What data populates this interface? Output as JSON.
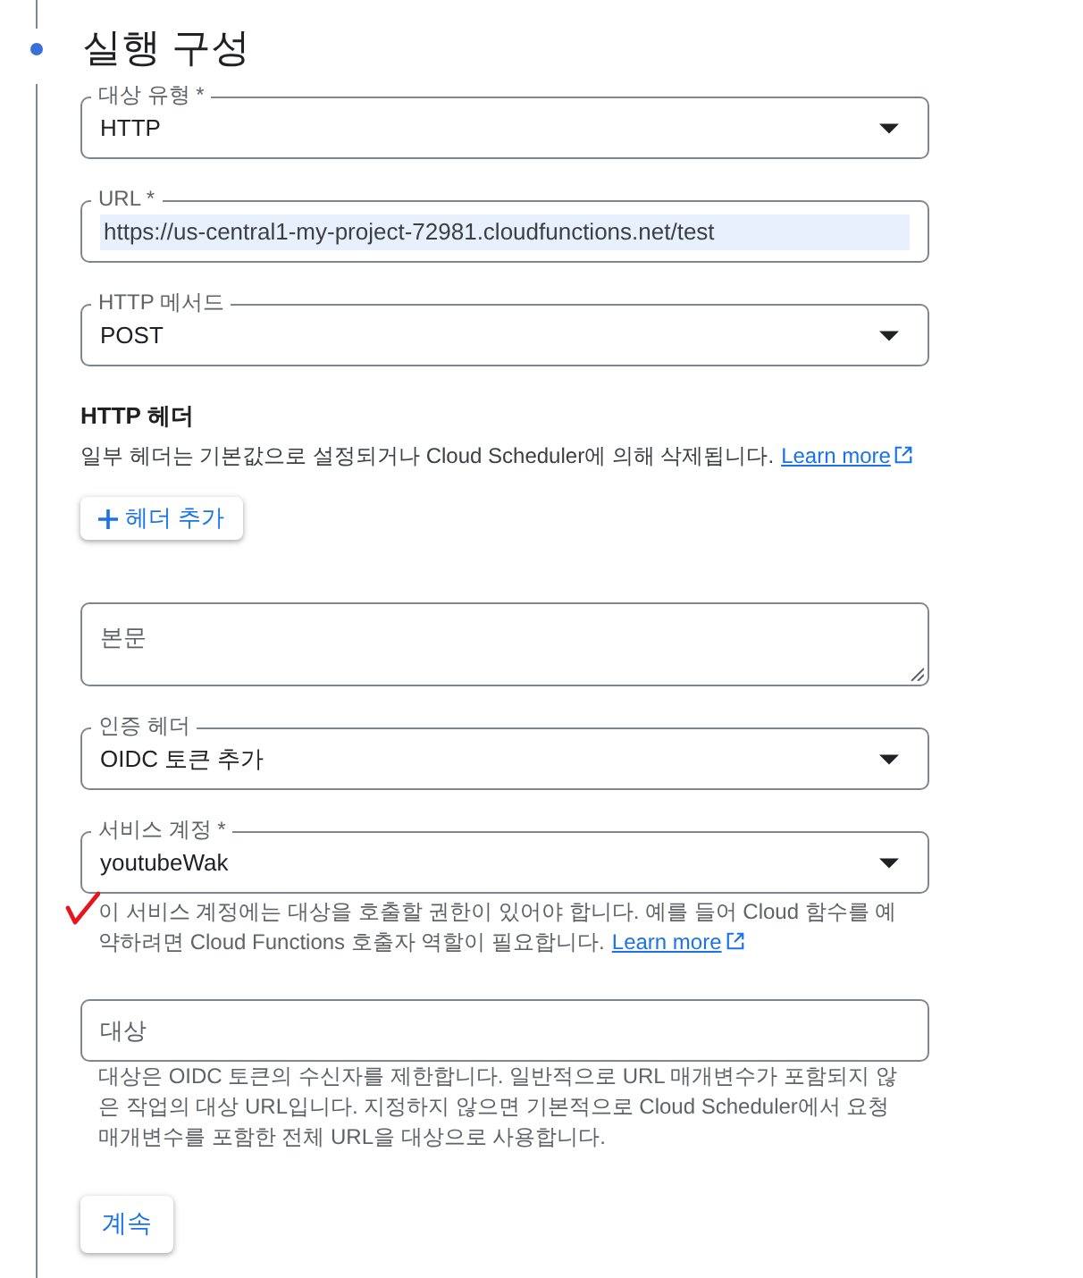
{
  "section": {
    "title": "실행 구성"
  },
  "fields": [
    {
      "kind": "select",
      "label": "대상 유형 *",
      "value": "HTTP"
    },
    {
      "kind": "input",
      "label": "URL *",
      "value": "https://us-central1-my-project-72981.cloudfunctions.net/test",
      "highlighted": true
    },
    {
      "kind": "select",
      "label": "HTTP 메서드",
      "value": "POST"
    },
    {
      "kind": "headers",
      "heading": "HTTP 헤더",
      "help": "일부 헤더는 기본값으로 설정되거나 Cloud Scheduler에 의해 삭제됩니다.",
      "link": "Learn more",
      "button": "헤더 추가"
    },
    {
      "kind": "textarea",
      "placeholder": "본문"
    },
    {
      "kind": "select",
      "label": "인증 헤더",
      "value": "OIDC 토큰 추가"
    },
    {
      "kind": "select",
      "label": "서비스 계정 *",
      "value": "youtubeWak",
      "help": "이 서비스 계정에는 대상을 호출할 권한이 있어야 합니다. 예를 들어 Cloud 함수를 예약하려면 Cloud Functions 호출자 역할이 필요합니다.",
      "link": "Learn more",
      "annotated": true
    },
    {
      "kind": "input",
      "placeholder": "대상",
      "help": "대상은 OIDC 토큰의 수신자를 제한합니다. 일반적으로 URL 매개변수가 포함되지 않은 작업의 대상 URL입니다. 지정하지 않으면 기본적으로 Cloud Scheduler에서 요청 매개변수를 포함한 전체 URL을 대상으로 사용합니다."
    }
  ],
  "continue_button": "계속"
}
